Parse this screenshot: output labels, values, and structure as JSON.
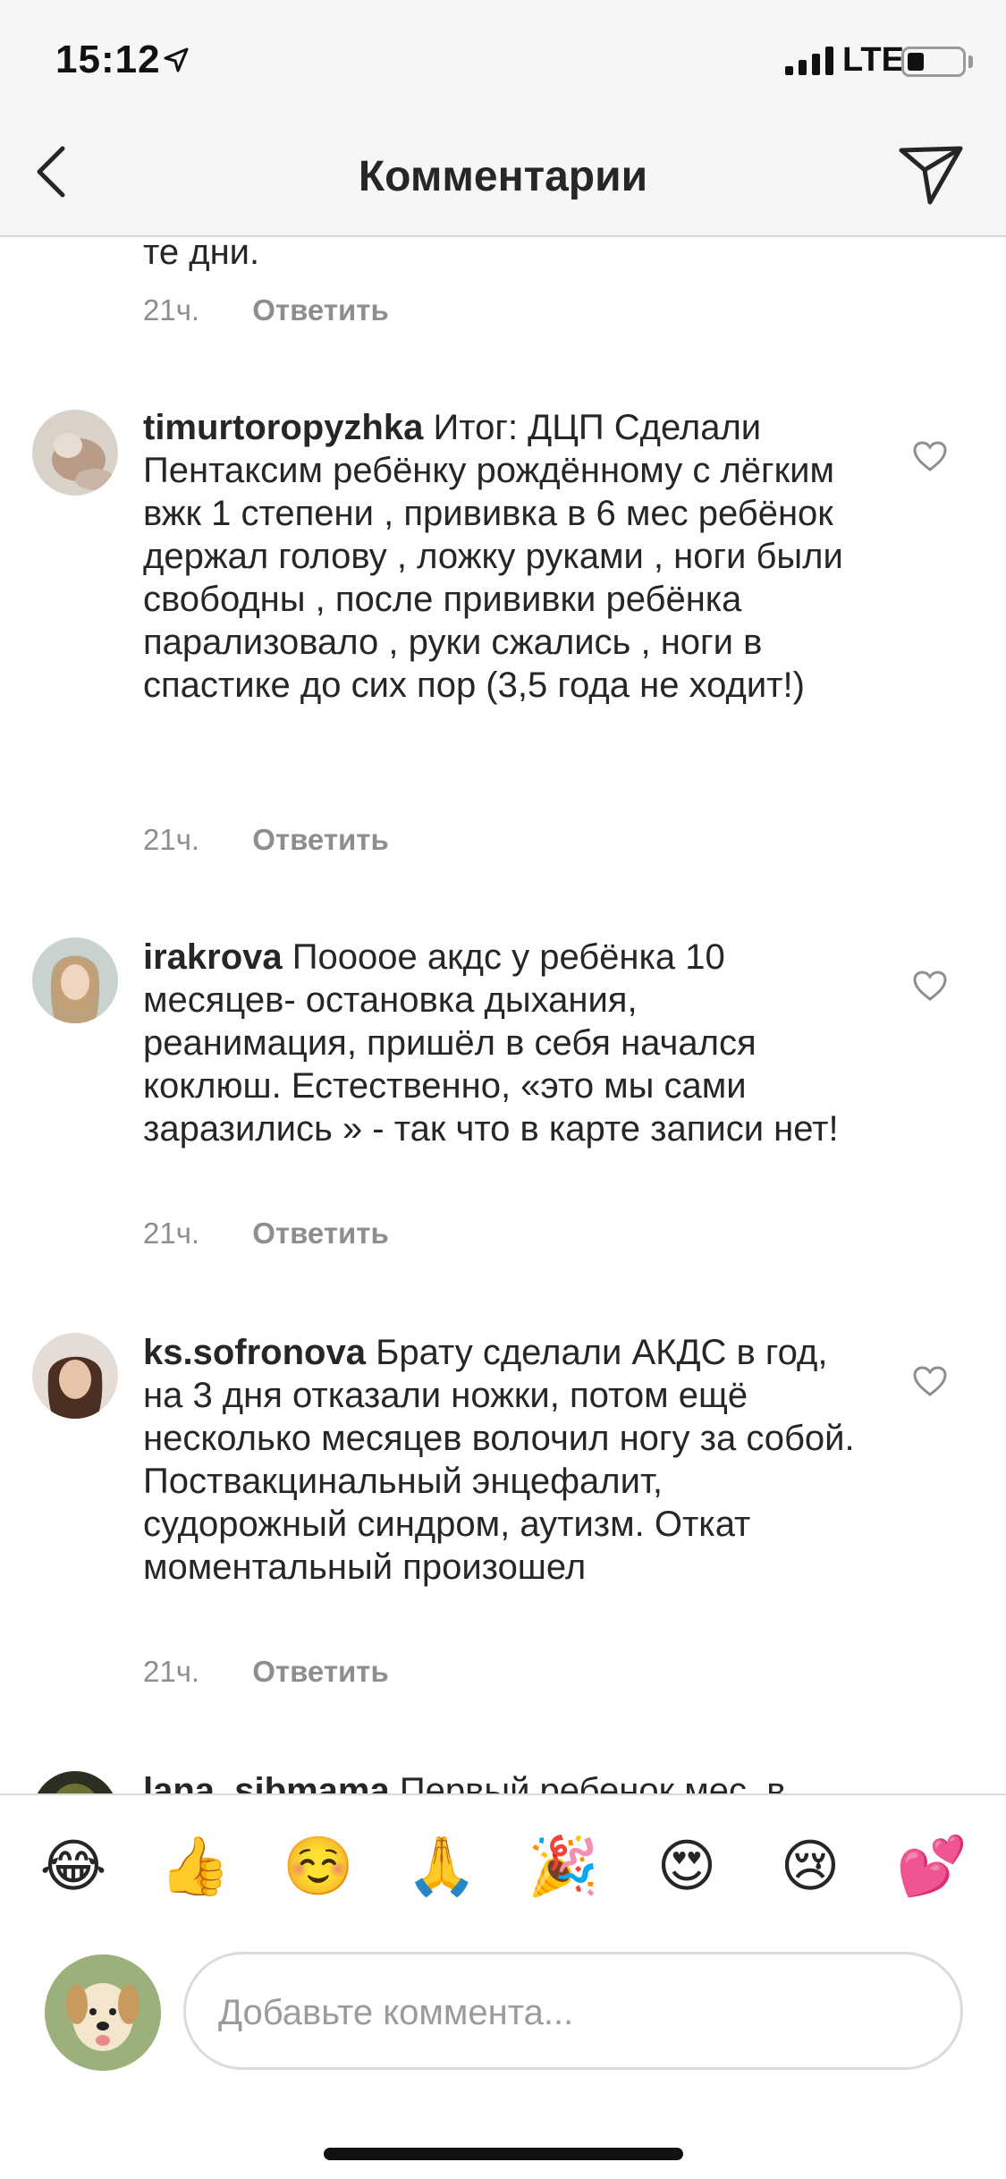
{
  "status": {
    "time": "15:12",
    "network": "LTE"
  },
  "header": {
    "title": "Комментарии"
  },
  "partial_top": {
    "text_tail": "те дни.",
    "time": "21ч.",
    "reply_label": "Ответить"
  },
  "comments": [
    {
      "username": "timurtoropyzhka",
      "text": "Итог: ДЦП Сделали Пентаксим ребёнку рождённому с лёгким вжк 1 степени , прививка в 6 мес ребёнок держал голову , ложку руками , ноги были свободны , после прививки ребёнка парализовало , руки сжались , ноги в спастике до сих пор (3,5 года не ходит!)",
      "time": "21ч.",
      "reply_label": "Ответить"
    },
    {
      "username": "irakrova",
      "text": "Поооое акдс у ребёнка 10 месяцев- остановка дыхания, реанимация, пришёл в себя начался коклюш. Естественно, «это мы сами заразились » - так что в карте записи нет!",
      "time": "21ч.",
      "reply_label": "Ответить"
    },
    {
      "username": "ks.sofronova",
      "text": "Брату сделали АКДС в год, на 3 дня отказали ножки, потом ещё несколько месяцев волочил ногу за собой. Поствакцинальный энцефалит, судорожный синдром, аутизм. Откат моментальный произошел",
      "time": "21ч.",
      "reply_label": "Ответить"
    },
    {
      "username": "lana_sibmama",
      "text": "Первый ребенок мес. в"
    }
  ],
  "emojis": [
    "😂",
    "👍",
    "☺️",
    "🙏",
    "🎉",
    "😍",
    "😢",
    "💕"
  ],
  "composer": {
    "placeholder": "Добавьте коммента..."
  }
}
